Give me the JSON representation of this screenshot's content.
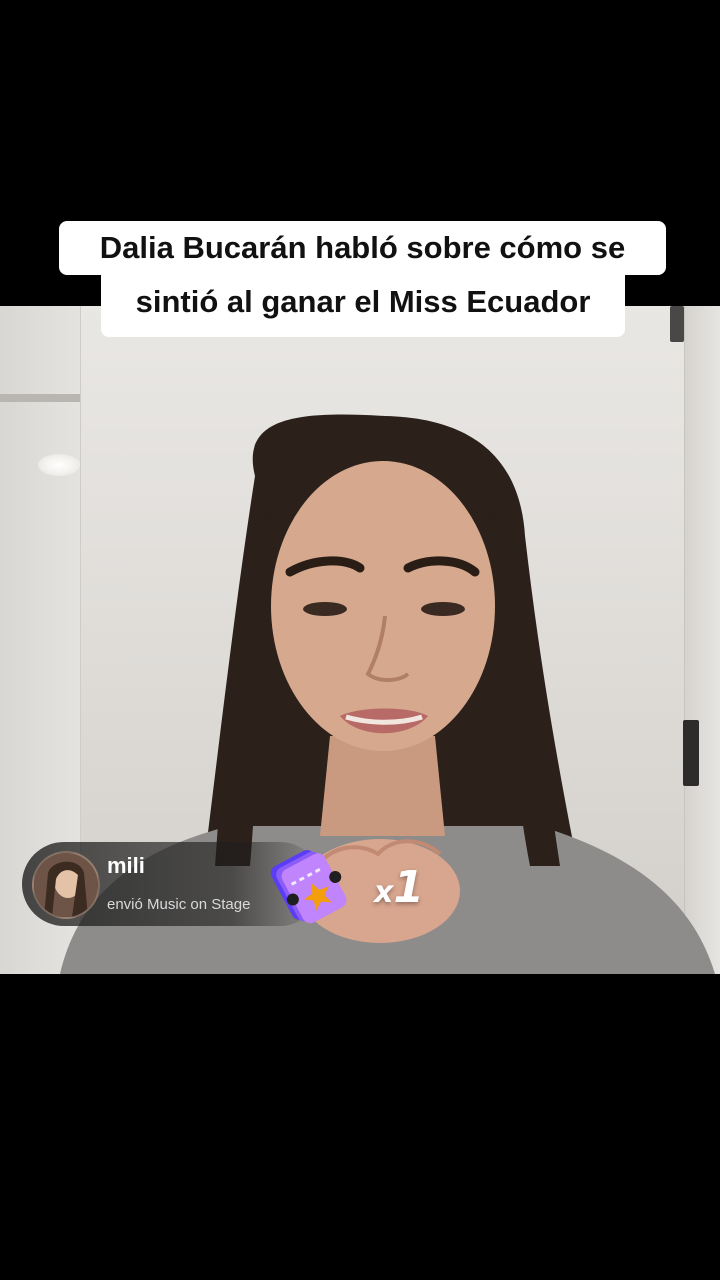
{
  "caption": {
    "line1": "Dalia Bucarán habló sobre cómo se",
    "line2": "sintió al ganar el Miss Ecuador"
  },
  "gift_notification": {
    "username": "mili",
    "action": "envió Music on Stage",
    "count_prefix": "x",
    "count": "1",
    "icon": "ticket-gift-icon"
  },
  "colors": {
    "caption_bg": "#ffffff",
    "caption_text": "#111111",
    "letterbox": "#000000",
    "gift_ticket": "#8b5cf6",
    "gift_accent": "#f59e0b"
  }
}
